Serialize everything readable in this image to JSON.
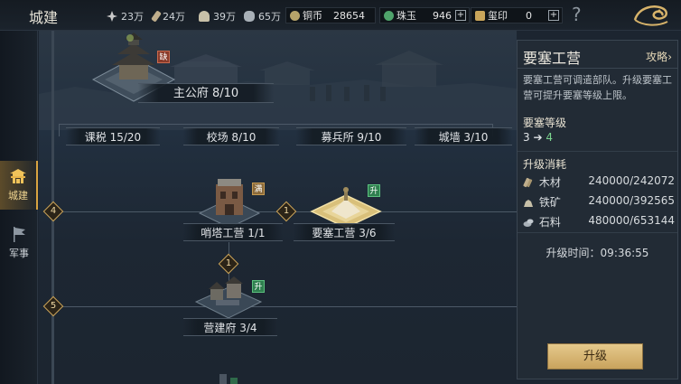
{
  "header": {
    "title": "城建",
    "resources": [
      {
        "icon": "grain-icon",
        "value": "23万"
      },
      {
        "icon": "wood-icon",
        "value": "24万"
      },
      {
        "icon": "iron-icon",
        "value": "39万"
      },
      {
        "icon": "stone-icon",
        "value": "65万"
      }
    ],
    "currencies": [
      {
        "label": "铜币",
        "value": "28654",
        "color": "#b6a36a"
      },
      {
        "label": "珠玉",
        "value": "946",
        "color": "#4fa36b"
      },
      {
        "label": "玺印",
        "value": "0",
        "color": "#c9a55a"
      }
    ],
    "help": "?"
  },
  "nav": {
    "items": [
      {
        "label": "城建",
        "active": true
      },
      {
        "label": "军事",
        "active": false
      }
    ]
  },
  "map": {
    "main_building": {
      "label": "主公府 8/10",
      "tag": "缺"
    },
    "row_labels": [
      "课税 15/20",
      "校场 8/10",
      "募兵所 9/10",
      "城墙 3/10"
    ],
    "row_level_markers": [
      "4",
      "5"
    ],
    "link_markers": [
      "1",
      "1"
    ],
    "buildings": [
      {
        "label": "哨塔工营 1/1",
        "tag": "满"
      },
      {
        "label": "要塞工营 3/6",
        "tag": "升"
      },
      {
        "label": "营建府 3/4",
        "tag": "升"
      }
    ]
  },
  "panel": {
    "title": "要塞工营",
    "guide": "攻略",
    "description": "要塞工营可调遣部队。升级要塞工营可提升要塞等级上限。",
    "level_heading": "要塞等级",
    "level_from": "3",
    "level_arrow": "➔",
    "level_to": "4",
    "cost_heading": "升级消耗",
    "costs": [
      {
        "icon": "wood-icon",
        "name": "木材",
        "value": "240000/242072"
      },
      {
        "icon": "iron-icon",
        "name": "铁矿",
        "value": "240000/392565"
      },
      {
        "icon": "stone-icon",
        "name": "石料",
        "value": "480000/653144"
      }
    ],
    "time_label": "升级时间：",
    "time_value": "09:36:55",
    "upgrade_button": "升级"
  }
}
